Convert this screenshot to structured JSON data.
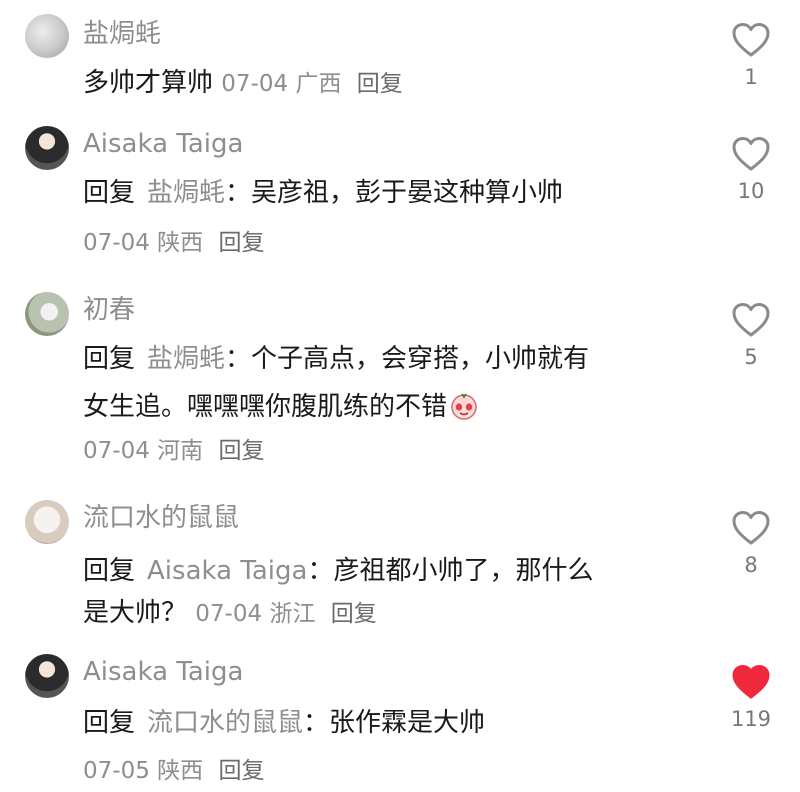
{
  "comments": [
    {
      "user": "盐焗蚝",
      "body": "多帅才算帅",
      "date": "07-04",
      "location": "广西",
      "reply_label": "回复",
      "likes": "1",
      "liked": false
    },
    {
      "user": "Aisaka Taiga",
      "prefix": "回复",
      "target": "盐焗蚝",
      "colon": "：",
      "body": "吴彦祖，彭于晏这种算小帅",
      "date": "07-04",
      "location": "陕西",
      "reply_label": "回复",
      "likes": "10",
      "liked": false
    },
    {
      "user": "初春",
      "prefix": "回复",
      "target": "盐焗蚝",
      "colon": "：",
      "body": "个子高点，会穿搭，小帅就有",
      "body2": "女生追。嘿嘿嘿你腹肌练的不错",
      "emoji": "shy-face-emoji",
      "date": "07-04",
      "location": "河南",
      "reply_label": "回复",
      "likes": "5",
      "liked": false
    },
    {
      "user": "流口水的鼠鼠",
      "prefix": "回复",
      "target": "Aisaka Taiga",
      "colon": "：",
      "body": "彦祖都小帅了，那什么",
      "body2": "是大帅？",
      "date": "07-04",
      "location": "浙江",
      "reply_label": "回复",
      "likes": "8",
      "liked": false
    },
    {
      "user": "Aisaka Taiga",
      "prefix": "回复",
      "target": "流口水的鼠鼠",
      "colon": "：",
      "body": "张作霖是大帅",
      "date": "07-05",
      "location": "陕西",
      "reply_label": "回复",
      "likes": "119",
      "liked": true
    }
  ],
  "colors": {
    "heart_outline": "#8a8a8a",
    "heart_liked": "#f0283c"
  }
}
